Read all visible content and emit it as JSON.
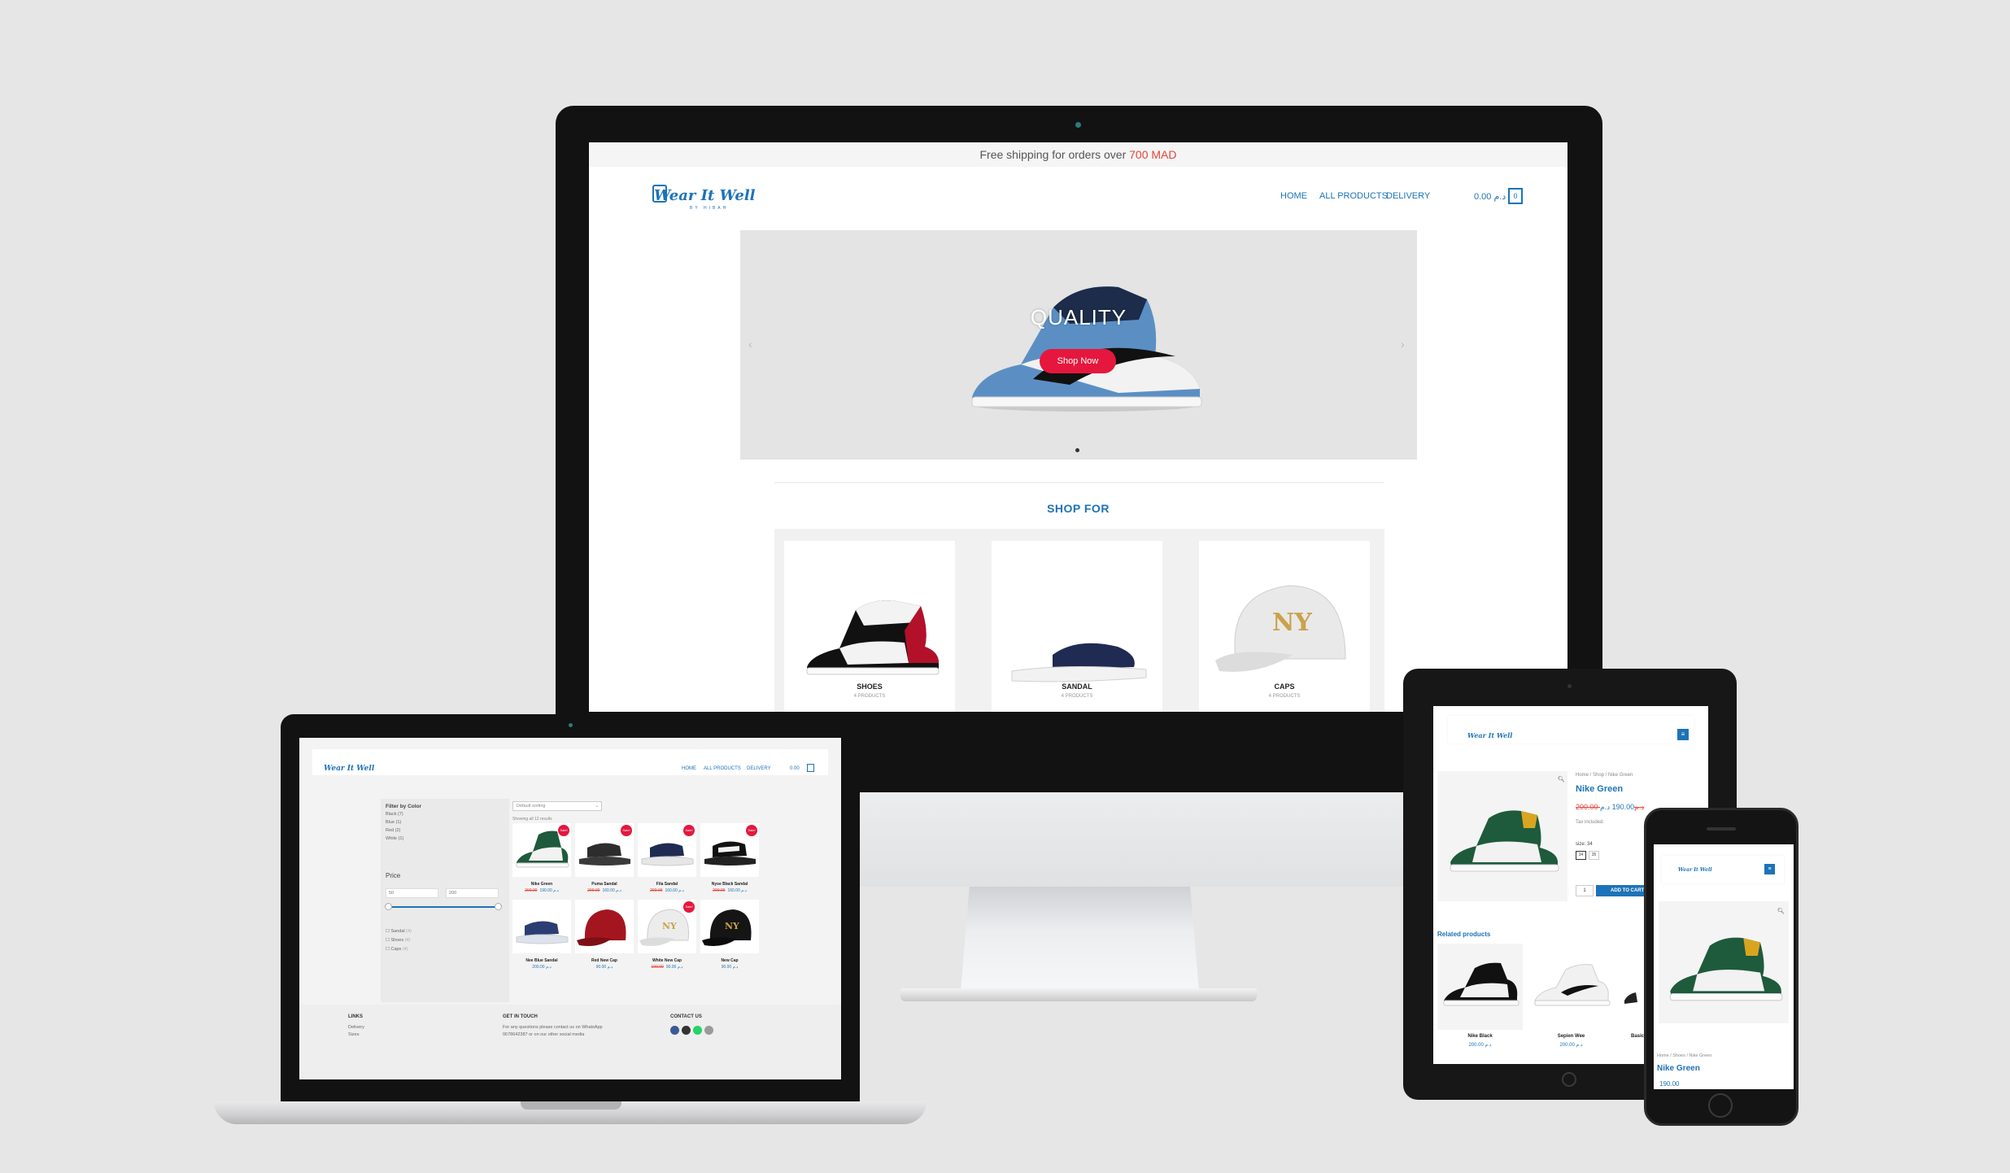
{
  "colors": {
    "background": "#e6e6e6",
    "accent": "#1d73b8",
    "sale_red": "#e5173e",
    "old_price": "#e0463a"
  },
  "monitor": {
    "banner_text": "Free shipping for orders over ",
    "banner_highlight": "700 MAD",
    "logo": "Wear It Well",
    "logo_sub": "BY HIBAH",
    "nav": [
      "HOME",
      "ALL PRODUCTS",
      "DELIVERY"
    ],
    "cart_total": "0.00 د.م",
    "cart_count": "0",
    "slide_caption": "QUALITY",
    "slide_button": "Shop Now",
    "section_title": "SHOP FOR",
    "categories": [
      {
        "label": "SHOES",
        "count": "4 PRODUCTS"
      },
      {
        "label": "SANDAL",
        "count": "4 PRODUCTS"
      },
      {
        "label": "CAPS",
        "count": "4 PRODUCTS"
      }
    ]
  },
  "laptop": {
    "logo": "Wear It Well",
    "nav": [
      "HOME",
      "ALL PRODUCTS",
      "DELIVERY"
    ],
    "cart_total": "0.00",
    "filter_title": "Filter by Color",
    "colors": [
      "Black (7)",
      "Blue (1)",
      "Red (2)",
      "White (1)"
    ],
    "price_title": "Price",
    "price_min": "50",
    "price_max": "200",
    "product_cats": [
      "Sandal",
      "Shoes",
      "Caps"
    ],
    "product_cat_counts": [
      "(4)",
      "(4)",
      "(4)"
    ],
    "sort_label": "Default sorting",
    "showing": "Showing all 12 results",
    "sale_badge": "Sale!",
    "products": [
      {
        "name": "Nike Green",
        "old": "200.00",
        "price": "190.00 د.م"
      },
      {
        "name": "Puma Sandal",
        "old": "200.00",
        "price": "160.00 د.م"
      },
      {
        "name": "Fila Sandal",
        "old": "200.00",
        "price": "160.00 د.م"
      },
      {
        "name": "Nyse Black Sandal",
        "old": "200.00",
        "price": "160.00 د.م"
      },
      {
        "name": "Nee Blue Sandal",
        "old": "",
        "price": "200.00 د.م"
      },
      {
        "name": "Red New Cap",
        "old": "",
        "price": "90.00 د.م"
      },
      {
        "name": "White New Cap",
        "old": "100.00",
        "price": "90.00 د.م"
      },
      {
        "name": "New Cap",
        "old": "",
        "price": "90.00 د.م"
      }
    ],
    "footer": {
      "links_title": "LINKS",
      "links": [
        "Delivery",
        "Sizes"
      ],
      "touch_title": "GET IN TOUCH",
      "touch_text": "For any questions please contact us on WhatsApp 0678642387 or on our other social media",
      "contact_title": "CONTACT US"
    }
  },
  "tablet": {
    "logo": "Wear It Well",
    "breadcrumb": "Home / Shop / Nike Green",
    "title": "Nike Green",
    "old_price": "200.00 د.م",
    "price": "190.00 د.م",
    "tax": "Tax included.",
    "size_label": "size: 34",
    "sizes": [
      "34",
      "35"
    ],
    "qty": "1",
    "add_to_cart": "ADD TO CART",
    "related_title": "Related products",
    "related": [
      {
        "name": "Nike Black",
        "price": "200.00 د.م"
      },
      {
        "name": "Sepien Wee",
        "price": "200.00 د.م"
      },
      {
        "name": "Basic",
        "price": ""
      }
    ]
  },
  "phone": {
    "logo": "Wear It Well",
    "breadcrumb": "Home / Shoes / Nike Green",
    "title": "Nike Green",
    "old_price": "",
    "price": "190.00"
  }
}
